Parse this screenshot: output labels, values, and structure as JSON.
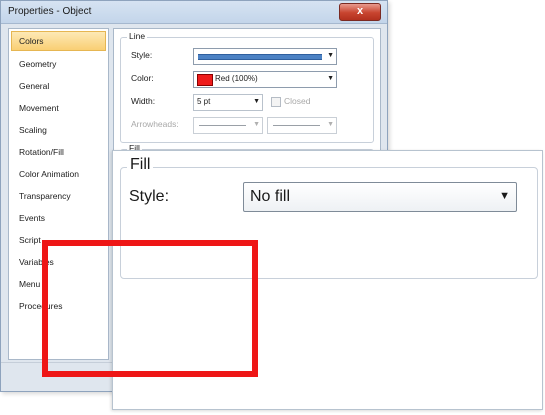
{
  "dialog": {
    "title": "Properties - Object",
    "close_label": "x"
  },
  "categories": [
    {
      "label": "Colors",
      "active": true
    },
    {
      "label": "Geometry"
    },
    {
      "label": "General"
    },
    {
      "label": "Movement"
    },
    {
      "label": "Scaling"
    },
    {
      "label": "Rotation/Fill"
    },
    {
      "label": "Color Animation"
    },
    {
      "label": "Transparency"
    },
    {
      "label": "Events"
    },
    {
      "label": "Script"
    },
    {
      "label": "Variables"
    },
    {
      "label": "Menu"
    },
    {
      "label": "Procedures"
    }
  ],
  "line_group": {
    "caption": "Line",
    "style_label": "Style:",
    "color_label": "Color:",
    "color_value": "Red (100%)",
    "width_label": "Width:",
    "width_value": "5 pt",
    "closed_label": "Closed",
    "closed_checked": false,
    "arrowheads_label": "Arrowheads:"
  },
  "fill_group_small": {
    "caption": "Fill"
  },
  "zoom": {
    "caption": "Fill",
    "style_label": "Style:",
    "style_value": "No fill"
  },
  "colors": {
    "highlight": "#ee1616",
    "line_color": "#ee1c1c",
    "active_category": "#f9cf74"
  }
}
